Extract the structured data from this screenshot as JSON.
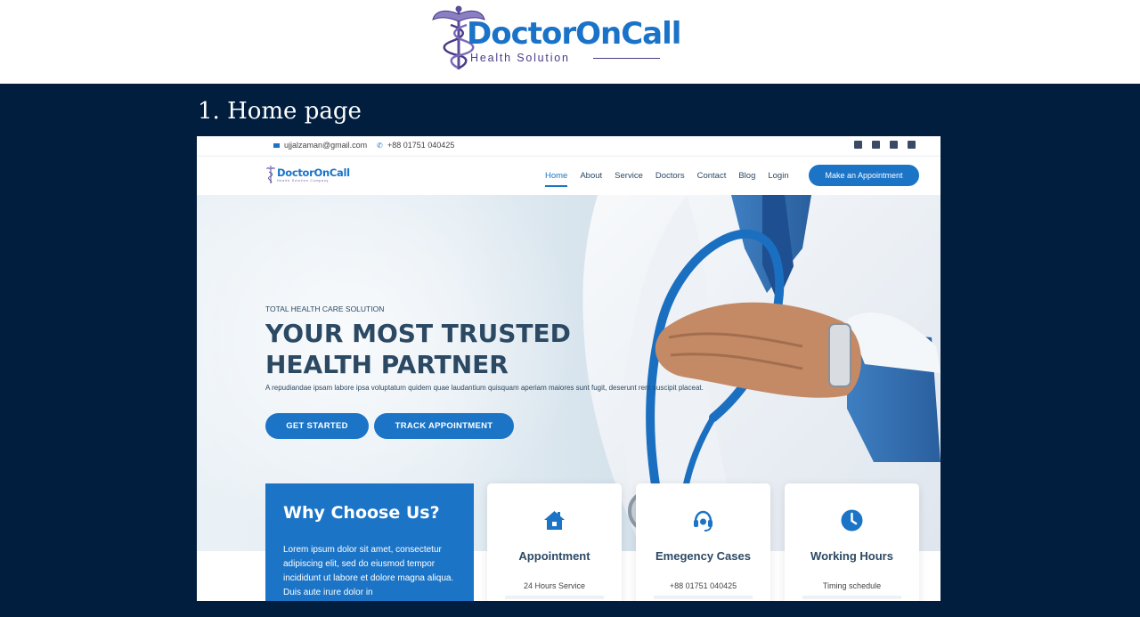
{
  "brand": {
    "name": "DoctorOnCall",
    "subtitle": "Health Solution"
  },
  "slide": {
    "title": "1. Home page"
  },
  "site": {
    "topbar": {
      "email": "ujjalzaman@gmail.com",
      "phone": "+88 01751 040425",
      "socials": [
        "linkedin-icon",
        "facebook-icon",
        "instagram-icon",
        "other-social-icon"
      ]
    },
    "nav": {
      "logo": "DoctorOnCall",
      "logo_sub": "Health Solution Company",
      "links": [
        "Home",
        "About",
        "Service",
        "Doctors",
        "Contact",
        "Blog",
        "Login"
      ],
      "active": "Home",
      "cta": "Make an Appointment"
    },
    "hero": {
      "kicker": "TOTAL HEALTH CARE SOLUTION",
      "title_line1": "YOUR MOST TRUSTED",
      "title_line2": "HEALTH PARTNER",
      "description": "A repudiandae ipsam labore ipsa voluptatum quidem quae laudantium quisquam aperiam maiores sunt fugit, deserunt rem suscipit placeat.",
      "buttons": {
        "start": "GET STARTED",
        "track": "TRACK APPOINTMENT"
      }
    },
    "why": {
      "title": "Why Choose Us?",
      "text": "Lorem ipsum dolor sit amet, consectetur adipiscing elit, sed do eiusmod tempor incididunt ut labore et dolore magna aliqua. Duis aute irure dolor in"
    },
    "cards": [
      {
        "icon": "home-icon",
        "title": "Appointment",
        "subtitle": "24 Hours Service"
      },
      {
        "icon": "headset-icon",
        "title": "Emegency Cases",
        "subtitle": "+88 01751 040425"
      },
      {
        "icon": "clock-icon",
        "title": "Working Hours",
        "subtitle": "Timing schedule"
      }
    ],
    "colors": {
      "primary": "#1b74c6",
      "heading": "#2c4964",
      "slide_bg": "#011e3f"
    }
  }
}
